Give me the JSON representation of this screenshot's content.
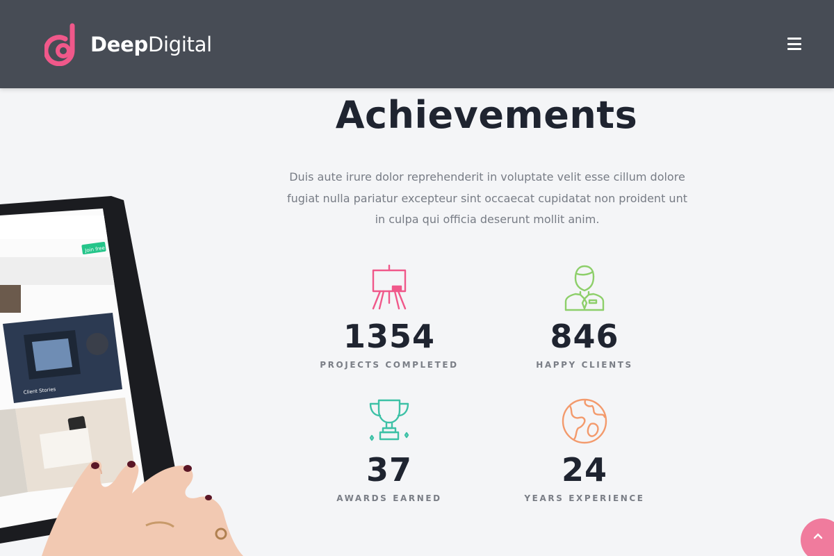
{
  "header": {
    "brand_bold": "Deep",
    "brand_light": "Digital",
    "menu_icon": "hamburger-menu-icon"
  },
  "section": {
    "title": "Achievements",
    "description": "Duis aute irure dolor reprehenderit in voluptate velit esse cillum dolore fugiat nulla pariatur excepteur sint occaecat cupidatat non proident unt in culpa qui officia deserunt mollit anim."
  },
  "stats": [
    {
      "icon": "easel-icon",
      "color": "#f0588a",
      "number": "1354",
      "label": "PROJECTS COMPLETED"
    },
    {
      "icon": "businessman-icon",
      "color": "#8dcf6a",
      "number": "846",
      "label": "HAPPY CLIENTS"
    },
    {
      "icon": "trophy-icon",
      "color": "#3cc1a6",
      "number": "37",
      "label": "AWARDS EARNED"
    },
    {
      "icon": "globe-icon",
      "color": "#f39a6c",
      "number": "24",
      "label": "YEARS EXPERIENCE"
    }
  ],
  "tablet_screen": {
    "button": "Join free",
    "caption": "Client Stories"
  },
  "colors": {
    "header_bg": "#474c55",
    "brand_accent": "#f0588a",
    "scroll_button": "#f07b9d"
  },
  "scroll_top_icon": "chevron-up-icon"
}
